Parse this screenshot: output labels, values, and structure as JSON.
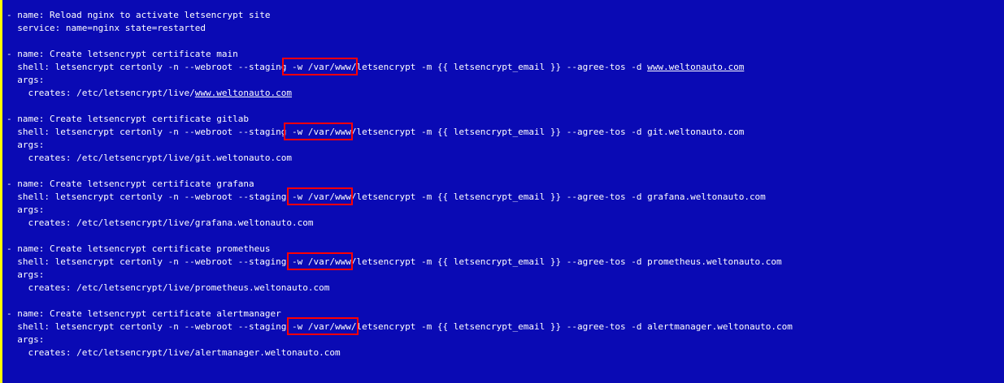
{
  "colors": {
    "background": "#0a0ab4",
    "text": "#ffffff",
    "highlight_border": "#ff0000",
    "left_border": "#ffff00"
  },
  "reload_task": {
    "name_line": "- name: Reload nginx to activate letsencrypt site",
    "service_line": "  service: name=nginx state=restarted"
  },
  "cert_tasks": [
    {
      "name_line": "- name: Create letsencrypt certificate main",
      "shell_prefix": "  shell: letsencrypt certonly -n --webroot ",
      "staging_flag": "--staging",
      "shell_middle": " -w /var/www/letsencrypt -m {{ letsencrypt_email }} --agree-tos -d ",
      "domain": "www.weltonauto.com",
      "args_line": "  args:",
      "creates_prefix": "    creates: /etc/letsencrypt/live/",
      "creates_domain": "www.weltonauto.com"
    },
    {
      "name_line": "- name: Create letsencrypt certificate gitlab",
      "shell_prefix": "  shell: letsencrypt certonly -n --webroot ",
      "staging_flag": "--staging",
      "shell_middle": " -w /var/www/letsencrypt -m {{ letsencrypt_email }} --agree-tos -d ",
      "domain": "git.weltonauto.com",
      "args_line": "  args:",
      "creates_prefix": "    creates: /etc/letsencrypt/live/",
      "creates_domain": "git.weltonauto.com"
    },
    {
      "name_line": "- name: Create letsencrypt certificate grafana",
      "shell_prefix": "  shell: letsencrypt certonly -n --webroot ",
      "staging_flag": "--staging",
      "shell_middle": " -w /var/www/letsencrypt -m {{ letsencrypt_email }} --agree-tos -d ",
      "domain": "grafana.weltonauto.com",
      "args_line": "  args:",
      "creates_prefix": "    creates: /etc/letsencrypt/live/",
      "creates_domain": "grafana.weltonauto.com"
    },
    {
      "name_line": "- name: Create letsencrypt certificate prometheus",
      "shell_prefix": "  shell: letsencrypt certonly -n --webroot ",
      "staging_flag": "--staging",
      "shell_middle": " -w /var/www/letsencrypt -m {{ letsencrypt_email }} --agree-tos -d ",
      "domain": "prometheus.weltonauto.com",
      "args_line": "  args:",
      "creates_prefix": "    creates: /etc/letsencrypt/live/",
      "creates_domain": "prometheus.weltonauto.com"
    },
    {
      "name_line": "- name: Create letsencrypt certificate alertmanager",
      "shell_prefix": "  shell: letsencrypt certonly -n --webroot ",
      "staging_flag": "--staging",
      "shell_middle": " -w /var/www/letsencrypt -m {{ letsencrypt_email }} --agree-tos -d ",
      "domain": "alertmanager.weltonauto.com",
      "args_line": "  args:",
      "creates_prefix": "    creates: /etc/letsencrypt/live/",
      "creates_domain": "alertmanager.weltonauto.com"
    }
  ]
}
